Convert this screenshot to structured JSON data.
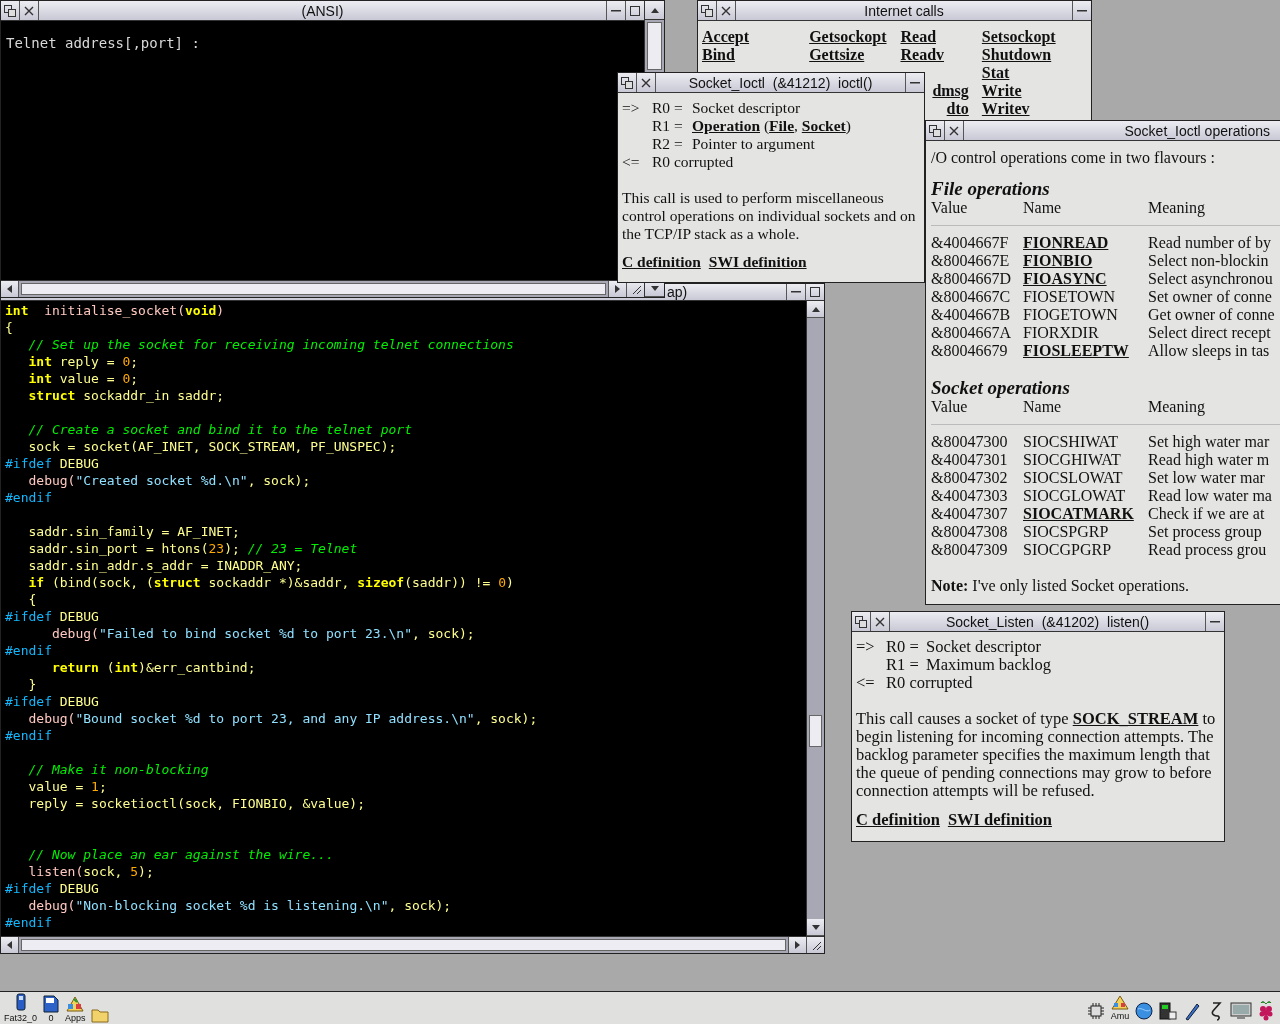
{
  "telnet_window": {
    "title": "(ANSI)",
    "lines": [
      "Telnet address[,port] :"
    ]
  },
  "code_window": {
    "title": "ap)",
    "lines": [
      {
        "kind": "code",
        "tokens": [
          {
            "t": "int",
            "kind": "kw"
          },
          {
            "t": "  initialise_socket(",
            "kind": "fn"
          },
          {
            "t": "void",
            "kind": "kw"
          },
          {
            "t": ")",
            "kind": "fn"
          }
        ]
      },
      {
        "kind": "code",
        "tokens": [
          {
            "t": "{",
            "kind": "id"
          }
        ]
      },
      {
        "kind": "code",
        "tokens": [
          {
            "t": "   // Set up the socket for receiving incoming telnet connections",
            "kind": "com"
          }
        ]
      },
      {
        "kind": "code",
        "tokens": [
          {
            "t": "   int",
            "kind": "kw"
          },
          {
            "t": " reply = ",
            "kind": "id"
          },
          {
            "t": "0",
            "kind": "num"
          },
          {
            "t": ";",
            "kind": "id"
          }
        ]
      },
      {
        "kind": "code",
        "tokens": [
          {
            "t": "   int",
            "kind": "kw"
          },
          {
            "t": " value = ",
            "kind": "id"
          },
          {
            "t": "0",
            "kind": "num"
          },
          {
            "t": ";",
            "kind": "id"
          }
        ]
      },
      {
        "kind": "code",
        "tokens": [
          {
            "t": "   struct",
            "kind": "kw"
          },
          {
            "t": " sockaddr_in saddr;",
            "kind": "id"
          }
        ]
      },
      {
        "kind": "blank"
      },
      {
        "kind": "code",
        "tokens": [
          {
            "t": "   // Create a socket and bind it to the telnet port",
            "kind": "com"
          }
        ]
      },
      {
        "kind": "code",
        "tokens": [
          {
            "t": "   sock = socket(AF_INET, SOCK_STREAM, PF_UNSPEC);",
            "kind": "id"
          }
        ]
      },
      {
        "kind": "code",
        "tokens": [
          {
            "t": "#ifdef",
            "kind": "pre"
          },
          {
            "t": " DEBUG",
            "kind": "id"
          }
        ]
      },
      {
        "kind": "code",
        "tokens": [
          {
            "t": "   debug(",
            "kind": "fn"
          },
          {
            "t": "\"Created socket %d.\\n\"",
            "kind": "str"
          },
          {
            "t": ", sock);",
            "kind": "id"
          }
        ]
      },
      {
        "kind": "code",
        "tokens": [
          {
            "t": "#endif",
            "kind": "pre"
          }
        ]
      },
      {
        "kind": "blank"
      },
      {
        "kind": "code",
        "tokens": [
          {
            "t": "   saddr.sin_family = AF_INET;",
            "kind": "id"
          }
        ]
      },
      {
        "kind": "code",
        "tokens": [
          {
            "t": "   saddr.sin_port = htons(",
            "kind": "id"
          },
          {
            "t": "23",
            "kind": "num"
          },
          {
            "t": "); ",
            "kind": "id"
          },
          {
            "t": "// 23 = Telnet",
            "kind": "com"
          }
        ]
      },
      {
        "kind": "code",
        "tokens": [
          {
            "t": "   saddr.sin_addr.s_addr = INADDR_ANY;",
            "kind": "id"
          }
        ]
      },
      {
        "kind": "code",
        "tokens": [
          {
            "t": "   if",
            "kind": "kw"
          },
          {
            "t": " (bind(sock, (",
            "kind": "id"
          },
          {
            "t": "struct",
            "kind": "kw"
          },
          {
            "t": " sockaddr *)&saddr, ",
            "kind": "id"
          },
          {
            "t": "sizeof",
            "kind": "kw"
          },
          {
            "t": "(saddr)) != ",
            "kind": "id"
          },
          {
            "t": "0",
            "kind": "num"
          },
          {
            "t": ")",
            "kind": "id"
          }
        ]
      },
      {
        "kind": "code",
        "tokens": [
          {
            "t": "   {",
            "kind": "id"
          }
        ]
      },
      {
        "kind": "code",
        "tokens": [
          {
            "t": "#ifdef",
            "kind": "pre"
          },
          {
            "t": " DEBUG",
            "kind": "id"
          }
        ]
      },
      {
        "kind": "code",
        "tokens": [
          {
            "t": "      debug(",
            "kind": "fn"
          },
          {
            "t": "\"Failed to bind socket %d to port 23.\\n\"",
            "kind": "str"
          },
          {
            "t": ", sock);",
            "kind": "id"
          }
        ]
      },
      {
        "kind": "code",
        "tokens": [
          {
            "t": "#endif",
            "kind": "pre"
          }
        ]
      },
      {
        "kind": "code",
        "tokens": [
          {
            "t": "      return",
            "kind": "kw"
          },
          {
            "t": " (",
            "kind": "id"
          },
          {
            "t": "int",
            "kind": "kw"
          },
          {
            "t": ")&err_cantbind;",
            "kind": "id"
          }
        ]
      },
      {
        "kind": "code",
        "tokens": [
          {
            "t": "   }",
            "kind": "id"
          }
        ]
      },
      {
        "kind": "code",
        "tokens": [
          {
            "t": "#ifdef",
            "kind": "pre"
          },
          {
            "t": " DEBUG",
            "kind": "id"
          }
        ]
      },
      {
        "kind": "code",
        "tokens": [
          {
            "t": "   debug(",
            "kind": "fn"
          },
          {
            "t": "\"Bound socket %d to port 23, and any IP address.\\n\"",
            "kind": "str"
          },
          {
            "t": ", sock);",
            "kind": "id"
          }
        ]
      },
      {
        "kind": "code",
        "tokens": [
          {
            "t": "#endif",
            "kind": "pre"
          }
        ]
      },
      {
        "kind": "blank"
      },
      {
        "kind": "code",
        "tokens": [
          {
            "t": "   // Make it non-blocking",
            "kind": "com"
          }
        ]
      },
      {
        "kind": "code",
        "tokens": [
          {
            "t": "   value = ",
            "kind": "id"
          },
          {
            "t": "1",
            "kind": "num"
          },
          {
            "t": ";",
            "kind": "id"
          }
        ]
      },
      {
        "kind": "code",
        "tokens": [
          {
            "t": "   reply = socketioctl(sock, FIONBIO, &value);",
            "kind": "id"
          }
        ]
      },
      {
        "kind": "blank"
      },
      {
        "kind": "blank"
      },
      {
        "kind": "code",
        "tokens": [
          {
            "t": "   // Now place an ear against the wire...",
            "kind": "com"
          }
        ]
      },
      {
        "kind": "code",
        "tokens": [
          {
            "t": "   listen(",
            "kind": "fn"
          },
          {
            "t": "sock, ",
            "kind": "id"
          },
          {
            "t": "5",
            "kind": "num"
          },
          {
            "t": ");",
            "kind": "id"
          }
        ]
      },
      {
        "kind": "code",
        "tokens": [
          {
            "t": "#ifdef",
            "kind": "pre"
          },
          {
            "t": " DEBUG",
            "kind": "id"
          }
        ]
      },
      {
        "kind": "code",
        "tokens": [
          {
            "t": "   debug(",
            "kind": "fn"
          },
          {
            "t": "\"Non-blocking socket %d is listening.\\n\"",
            "kind": "str"
          },
          {
            "t": ", sock);",
            "kind": "id"
          }
        ]
      },
      {
        "kind": "code",
        "tokens": [
          {
            "t": "#endif",
            "kind": "pre"
          }
        ]
      }
    ]
  },
  "internet_calls": {
    "title": "Internet calls",
    "columns": [
      [
        {
          "text": "Accept",
          "kind": "link"
        },
        {
          "text": "Bind",
          "kind": "link"
        }
      ],
      [
        {
          "text": "Getsockopt",
          "kind": "link"
        },
        {
          "text": "Gettsize",
          "kind": "link"
        }
      ],
      [
        {
          "text": "Read",
          "kind": "link"
        },
        {
          "text": "Readv",
          "kind": "link"
        },
        {
          "kind": "covered"
        },
        {
          "text": "dmsg",
          "kind": "clipped"
        },
        {
          "text": "dto",
          "kind": "clipped"
        }
      ],
      [
        {
          "text": "Setsockopt",
          "kind": "link"
        },
        {
          "text": "Shutdown",
          "kind": "link"
        },
        {
          "text": "Stat",
          "kind": "link"
        },
        {
          "text": "Write",
          "kind": "link"
        },
        {
          "text": "Writev",
          "kind": "link"
        }
      ]
    ]
  },
  "ioctl_window": {
    "title": "Socket_Ioctl  (&41212)  ioctl()",
    "registers": [
      {
        "dir": "=>",
        "reg": "R0 =",
        "parts": [
          {
            "text": "Socket descriptor"
          }
        ]
      },
      {
        "reg": "R1 =",
        "parts": [
          {
            "text": "Operation",
            "link": true
          },
          {
            "text": " ("
          },
          {
            "text": "File",
            "link": true
          },
          {
            "text": ", "
          },
          {
            "text": "Socket",
            "link": true
          },
          {
            "text": ")"
          }
        ]
      },
      {
        "reg": "R2 =",
        "parts": [
          {
            "text": "Pointer to argument"
          }
        ]
      },
      {
        "dir": "<=",
        "parts": [
          {
            "text": "R0 corrupted"
          }
        ]
      }
    ],
    "description": [
      {
        "text": "This call is used to perform miscellaneous control operations on individual sockets and on the TCP/IP stack as a whole."
      }
    ],
    "links": [
      "C definition",
      "SWI definition"
    ]
  },
  "ops_window": {
    "title": "Socket_Ioctl operations",
    "intro": "/O control operations come in two flavours :",
    "sections": [
      {
        "heading": "File operations",
        "columns": [
          "Value",
          "Name",
          "Meaning"
        ],
        "rows": [
          {
            "value": "&4004667F",
            "name": "FIONREAD",
            "link": true,
            "meaning": "Read number of by"
          },
          {
            "value": "&8004667E",
            "name": "FIONBIO",
            "link": true,
            "meaning": "Select non-blockin"
          },
          {
            "value": "&8004667D",
            "name": "FIOASYNC",
            "link": true,
            "meaning": "Select asynchronou"
          },
          {
            "value": "&8004667C",
            "name": "FIOSETOWN",
            "link": false,
            "meaning": "Set owner of conne"
          },
          {
            "value": "&4004667B",
            "name": "FIOGETOWN",
            "link": false,
            "meaning": "Get owner of conne"
          },
          {
            "value": "&8004667A",
            "name": "FIORXDIR",
            "link": false,
            "meaning": "Select direct recept"
          },
          {
            "value": "&80046679",
            "name": "FIOSLEEPTW",
            "link": true,
            "meaning": "Allow sleeps in tas"
          }
        ]
      },
      {
        "heading": "Socket operations",
        "columns": [
          "Value",
          "Name",
          "Meaning"
        ],
        "rows": [
          {
            "value": "&80047300",
            "name": "SIOCSHIWAT",
            "link": false,
            "meaning": "Set high water mar"
          },
          {
            "value": "&40047301",
            "name": "SIOCGHIWAT",
            "link": false,
            "meaning": "Read high water m"
          },
          {
            "value": "&80047302",
            "name": "SIOCSLOWAT",
            "link": false,
            "meaning": "Set low water mar"
          },
          {
            "value": "&40047303",
            "name": "SIOCGLOWAT",
            "link": false,
            "meaning": "Read low water ma"
          },
          {
            "value": "&40047307",
            "name": "SIOCATMARK",
            "link": true,
            "meaning": "Check if we are at"
          },
          {
            "value": "&80047308",
            "name": "SIOCSPGRP",
            "link": false,
            "meaning": "Set process group"
          },
          {
            "value": "&80047309",
            "name": "SIOCGPGRP",
            "link": false,
            "meaning": "Read process grou"
          }
        ]
      }
    ],
    "note": "**Note:** I've only listed Socket operations."
  },
  "listen_window": {
    "title": "Socket_Listen  (&41202)  listen()",
    "registers": [
      {
        "dir": "=>",
        "reg": "R0 =",
        "parts": [
          {
            "text": "Socket descriptor"
          }
        ]
      },
      {
        "reg": "R1 =",
        "parts": [
          {
            "text": "Maximum backlog"
          }
        ]
      },
      {
        "dir": "<=",
        "parts": [
          {
            "text": "R0 corrupted"
          }
        ]
      }
    ],
    "description": [
      {
        "text": "This call causes a socket of type "
      },
      {
        "text": "SOCK_STREAM",
        "link": true
      },
      {
        "text": " to begin listening for incoming connection attempts. The backlog parameter specifies the maximum length that the queue of pending connections may grow to before connection attempts will be refused."
      }
    ],
    "links": [
      "C definition",
      "SWI definition"
    ]
  },
  "iconbar": {
    "left": [
      {
        "kind": "drive",
        "label": "Fat32_0"
      },
      {
        "kind": "card",
        "label": "0"
      },
      {
        "kind": "apps",
        "label": "Apps"
      },
      {
        "kind": "folder"
      }
    ],
    "right": [
      {
        "kind": "chip"
      },
      {
        "kind": "apps",
        "label": "Amu"
      },
      {
        "kind": "globe"
      },
      {
        "kind": "display"
      },
      {
        "kind": "pen"
      },
      {
        "kind": "squiggle"
      },
      {
        "kind": "monitor"
      },
      {
        "kind": "raspberry"
      }
    ]
  }
}
